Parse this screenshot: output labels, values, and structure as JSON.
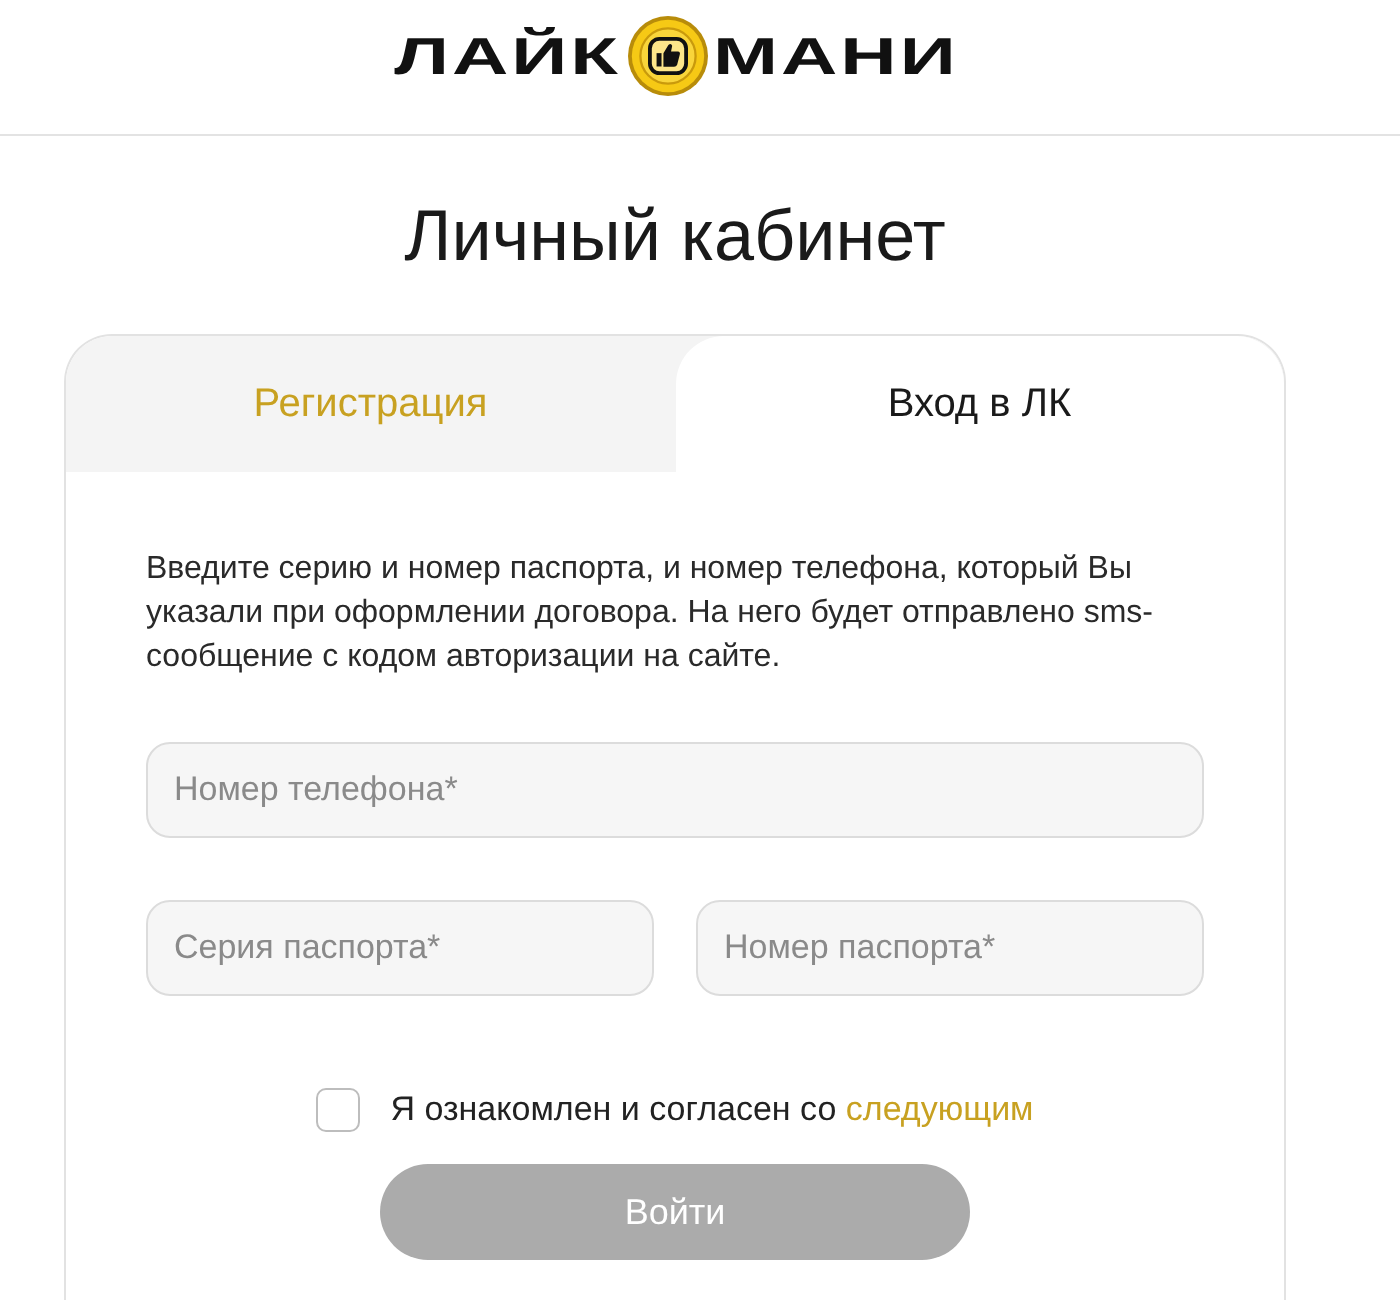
{
  "header": {
    "logo": {
      "word_1": "ЛАЙК",
      "word_2": "МАНИ"
    }
  },
  "title": "Личный кабинет",
  "tabs": [
    {
      "label": "Регистрация",
      "selected": false
    },
    {
      "label": "Вход в ЛК",
      "selected": true
    }
  ],
  "intro": "Введите серию и номер паспорта, и номер телефона, который Вы указали при оформлении договора. На него будет отправлено sms-сообщение с кодом авторизации на сайте.",
  "phone_field": {
    "placeholder": "Номер телефона*"
  },
  "passport_fields": [
    {
      "placeholder": "Серия паспорта*"
    },
    {
      "placeholder": "Номер паспорта*"
    }
  ],
  "consent": {
    "checked": false,
    "text": "Я ознакомлен и согласен со",
    "link": "следующим"
  },
  "submit": {
    "label": "Войти",
    "disabled": true
  }
}
